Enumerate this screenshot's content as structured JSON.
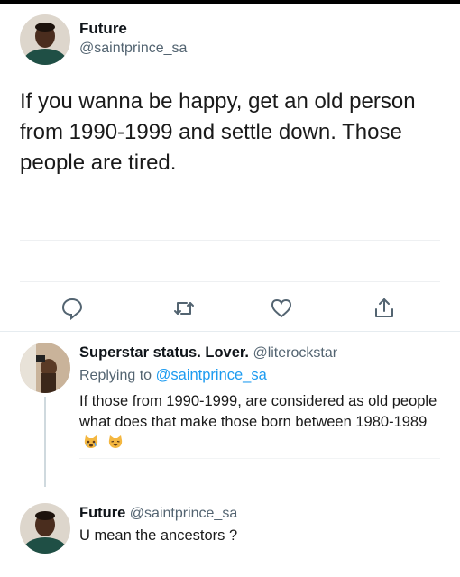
{
  "main_tweet": {
    "name": "Future",
    "handle": "@saintprince_sa",
    "text": "If you wanna be happy, get an old person from 1990-1999 and settle down. Those people are tired."
  },
  "actions": [
    {
      "icon": "reply-icon"
    },
    {
      "icon": "retweet-icon"
    },
    {
      "icon": "like-icon"
    },
    {
      "icon": "share-icon"
    }
  ],
  "reply_1": {
    "name": "Superstar status. Lover.",
    "handle": "@literockstar",
    "replying_prefix": "Replying to",
    "replying_to": "@saintprince_sa",
    "text": "If those from 1990-1999, are considered as old people what does that make those born between 1980-1989",
    "emojis": [
      "crying-cat-emoji",
      "laughing-cat-emoji"
    ]
  },
  "reply_2": {
    "name": "Future",
    "handle": "@saintprince_sa",
    "text": "U mean the ancestors ?"
  },
  "colors": {
    "link": "#1d9bf0",
    "secondary_text": "#536471",
    "icon": "#536471"
  }
}
